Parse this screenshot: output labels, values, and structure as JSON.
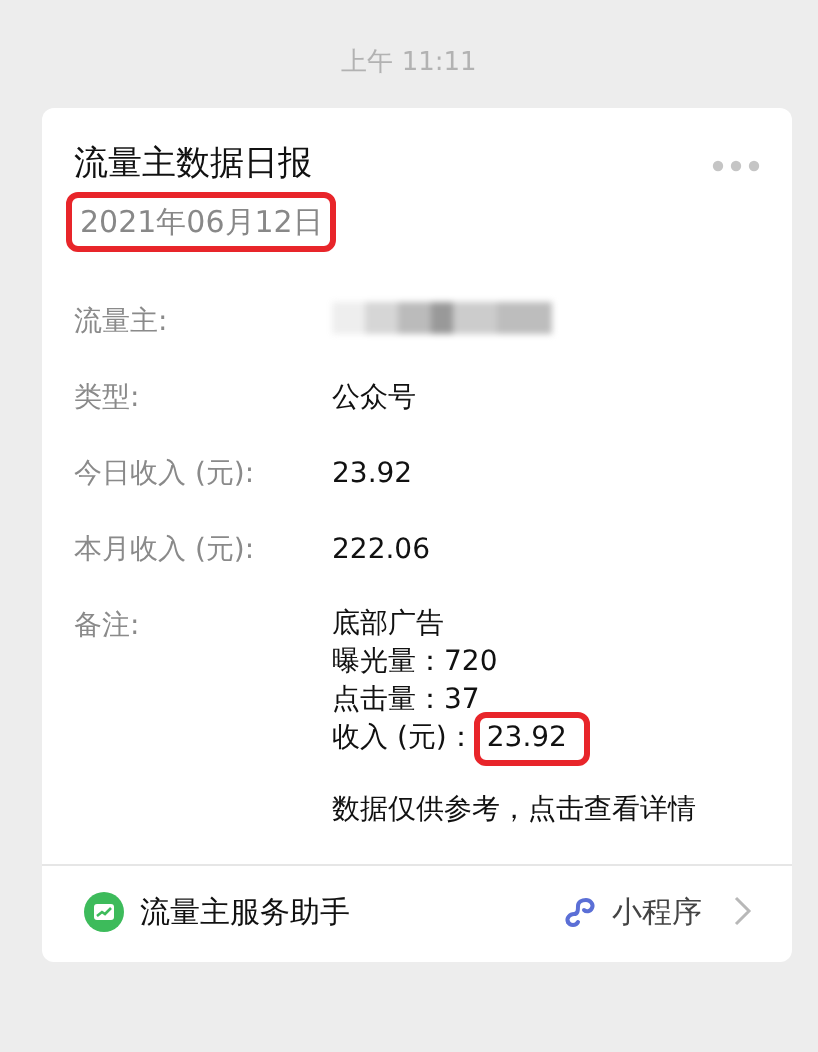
{
  "timestamp": "上午 11:11",
  "card": {
    "title": "流量主数据日报",
    "date": "2021年06月12日",
    "date_highlighted": true,
    "rows": [
      {
        "label": "流量主:",
        "kind": "redacted"
      },
      {
        "label": "类型:",
        "kind": "text",
        "value": "公众号"
      },
      {
        "label": "今日收入 (元):",
        "kind": "text",
        "value": "23.92"
      },
      {
        "label": "本月收入 (元):",
        "kind": "text",
        "value": "222.06"
      },
      {
        "label": "备注:",
        "kind": "lines",
        "lines": [
          {
            "text": "底部广告"
          },
          {
            "text": "曝光量：720"
          },
          {
            "text": "点击量：37"
          },
          {
            "text": "收入 (元)：",
            "value": "23.92",
            "highlighted": true
          }
        ]
      }
    ],
    "note": "数据仅供参考，点击查看详情",
    "footer": {
      "app_name": "流量主服务助手",
      "tag": "小程序"
    }
  }
}
